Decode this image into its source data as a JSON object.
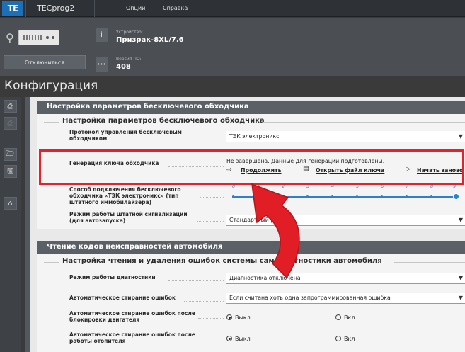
{
  "window": {
    "logo_text": "TE",
    "app_title": "TECprog2",
    "menu": [
      "Опции",
      "Справка"
    ]
  },
  "device": {
    "device_label": "Устройство:",
    "device_name": "Призрак-8XL/7.6",
    "version_label": "Версия ПО:",
    "version_value": "408",
    "disconnect_label": "Отключиться",
    "info_glyph": "i",
    "more_glyph": "•••"
  },
  "page_title": "Конфигурация",
  "toolbar_glyphs": [
    "⎙",
    "⎙",
    "🗁",
    "🖫",
    "⌂"
  ],
  "section1": {
    "header": "Настройка параметров бесключевого обходчика",
    "subheader": "Настройка параметров бесключевого обходчика",
    "protocol_label": "Протокол управления бесключевым обходчиком",
    "protocol_value": "ТЭК электроникс",
    "keygen_label": "Генерация ключа обходчика",
    "keygen_status": "Не завершена. Данные для генерации подготовлены.",
    "action_continue": "Продолжить",
    "action_open": "Открыть файл ключа",
    "action_restart": "Начать заново",
    "connection_label": "Способ подключения бесключевого обходчика «ТЭК электроникс» (тип штатного иммобилайзера)",
    "slider_ticks": [
      "0",
      "1",
      "2",
      "3",
      "4",
      "5",
      "6",
      "7",
      "8",
      "9"
    ],
    "slider_value": 9,
    "alarm_label": "Режим работы штатной сигнализации (для автозапуска)",
    "alarm_value": "Стандартный режим"
  },
  "section2": {
    "header": "Чтение кодов неисправностей автомобиля",
    "subheader": "Настройка чтения и удаления ошибок системы самодиагностики автомобиля",
    "diag_label": "Режим работы диагностики",
    "diag_value": "Диагностика отключена",
    "autoclear_label": "Автоматическое стирание ошибок",
    "autoclear_value": "Если считана хоть одна запрограммированная ошибка",
    "engine_lock_label": "Автоматическое стирание ошибок после блокировки двигателя",
    "heater_label": "Автоматическое стирание ошибок после работы отопителя",
    "off_label": "Выкл",
    "on_label": "Вкл"
  },
  "colors": {
    "accent": "#2e7fcf",
    "highlight": "#e8202a",
    "annotation_arrow": "#e11e26"
  }
}
